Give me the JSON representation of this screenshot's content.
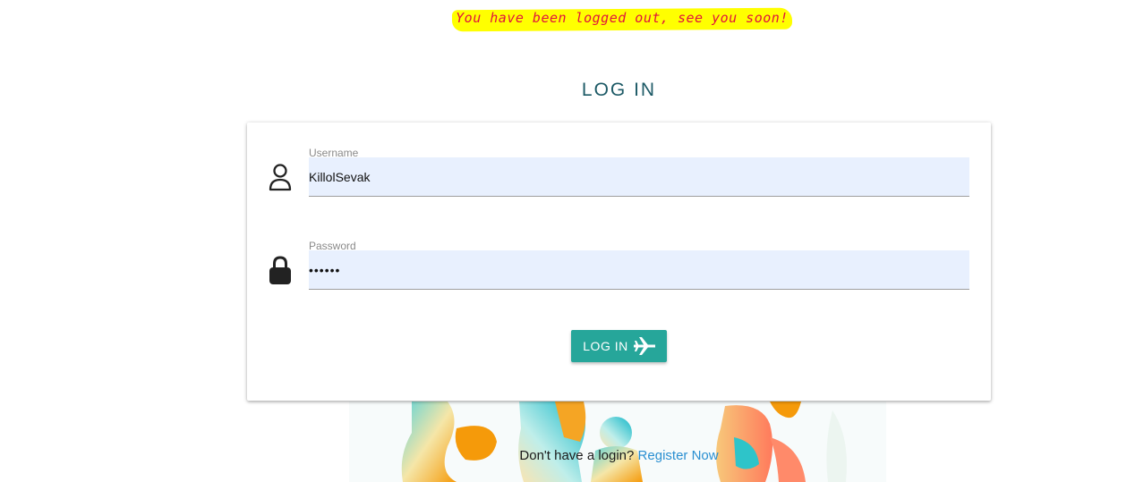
{
  "flash": {
    "message": "You have been logged out, see you soon!"
  },
  "page": {
    "title": "LOG IN"
  },
  "form": {
    "username": {
      "label": "Username",
      "value": "KillolSevak",
      "icon": "person-outline-icon"
    },
    "password": {
      "label": "Password",
      "value": "••••••",
      "icon": "lock-icon"
    },
    "submit": {
      "label": "LOG IN",
      "icon": "airplane-icon"
    }
  },
  "register": {
    "prompt": "Don't have a login?",
    "link_label": "Register Now"
  },
  "colors": {
    "accent": "#26a69a",
    "link": "#2a8fd1",
    "title": "#1d5a66",
    "flash_bg": "#ffff00",
    "flash_text": "#e0143c",
    "input_bg": "#e8f0fe"
  }
}
